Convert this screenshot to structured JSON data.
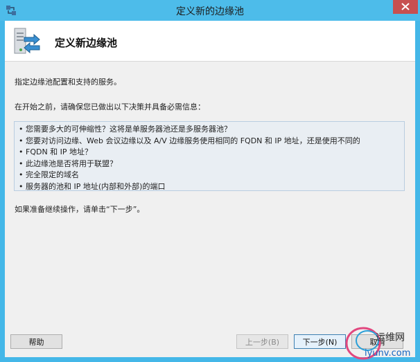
{
  "window": {
    "title": "定义新的边缘池",
    "close_icon": "close-icon"
  },
  "header": {
    "title": "定义新边缘池",
    "icon": "server-pool-arrows-icon"
  },
  "body": {
    "intro": "指定边缘池配置和支持的服务。",
    "prereq_intro": "在开始之前，请确保您已做出以下决策并具备必需信息：",
    "requirements": [
      "您需要多大的可伸缩性？这将是单服务器池还是多服务器池？",
      "您要对访问边缘、Web 会议边缘以及 A/V 边缘服务使用相同的 FQDN 和 IP 地址，还是使用不同的",
      "FQDN 和 IP 地址？",
      "此边缘池是否将用于联盟？",
      "完全限定的域名",
      "服务器的池和 IP 地址(内部和外部)的端口"
    ],
    "ready": "如果准备继续操作，请单击“下一步”。"
  },
  "buttons": {
    "help": "帮助",
    "back": "上一步(B)",
    "next": "下一步(N)",
    "cancel": "取消"
  },
  "watermark": {
    "text": "运维网",
    "url": "iyunv.com"
  }
}
